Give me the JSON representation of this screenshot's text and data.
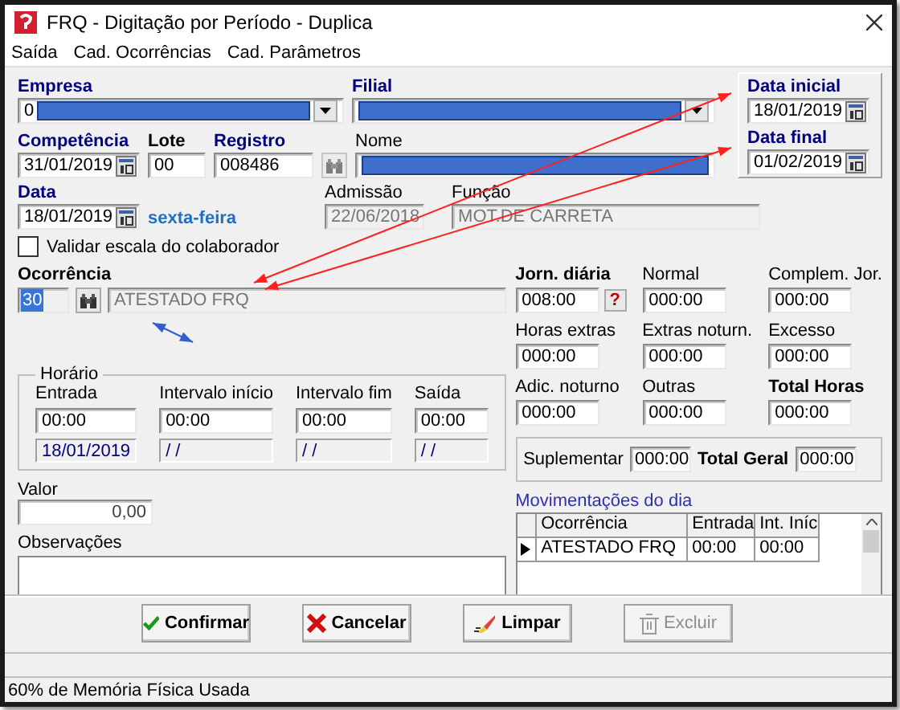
{
  "window": {
    "title": "FRQ - Digitação por Período - Duplica"
  },
  "menu": [
    {
      "label": "Saída"
    },
    {
      "label": "Cad. Ocorrências"
    },
    {
      "label": "Cad. Parâmetros"
    }
  ],
  "empresa": {
    "label": "Empresa",
    "value": "0",
    "kind": "required"
  },
  "filial": {
    "label": "Filial",
    "kind": "required"
  },
  "data_inicial": {
    "label": "Data inicial",
    "value": "18/01/2019",
    "kind": "required"
  },
  "data_final": {
    "label": "Data final",
    "value": "01/02/2019",
    "kind": "required"
  },
  "competencia": {
    "label": "Competência",
    "value": "31/01/2019",
    "kind": "required"
  },
  "lote": {
    "label": "Lote",
    "value": "00",
    "kind": "bold"
  },
  "registro": {
    "label": "Registro",
    "value": "008486",
    "kind": "required"
  },
  "nome": {
    "label": "Nome"
  },
  "data": {
    "label": "Data",
    "value": "18/01/2019",
    "kind": "required",
    "weekday": "sexta-feira"
  },
  "admissao": {
    "label": "Admissão",
    "value": "22/06/2018",
    "disabled": true
  },
  "funcao": {
    "label": "Função",
    "value": "MOT.DE CARRETA",
    "disabled": true
  },
  "validar": {
    "label": "Validar escala do colaborador",
    "checked": false
  },
  "ocorrencia": {
    "label": "Ocorrência",
    "kind": "bold",
    "code": "30",
    "description": "ATESTADO FRQ"
  },
  "horario": {
    "title": "Horário",
    "columns": [
      {
        "label": "Entrada",
        "time": "00:00",
        "date": "18/01/2019"
      },
      {
        "label": "Intervalo início",
        "time": "00:00",
        "date": "/ /"
      },
      {
        "label": "Intervalo fim",
        "time": "00:00",
        "date": "/ /"
      },
      {
        "label": "Saída",
        "time": "00:00",
        "date": "/ /"
      }
    ]
  },
  "valor": {
    "label": "Valor",
    "value": "0,00"
  },
  "observacoes": {
    "label": "Observações"
  },
  "totals": [
    {
      "label": "Jorn. diária",
      "value": "008:00",
      "kind": "bold",
      "help": "?"
    },
    {
      "label": "Normal",
      "value": "000:00",
      "kind": "plain"
    },
    {
      "label": "Complem. Jor.",
      "value": "000:00",
      "kind": "plain"
    },
    {
      "label": "Horas extras",
      "value": "000:00",
      "kind": "plain"
    },
    {
      "label": "Extras noturn.",
      "value": "000:00",
      "kind": "plain"
    },
    {
      "label": "Excesso",
      "value": "000:00",
      "kind": "plain"
    },
    {
      "label": "Adic. noturno",
      "value": "000:00",
      "kind": "plain"
    },
    {
      "label": "Outras",
      "value": "000:00",
      "kind": "plain"
    },
    {
      "label": "Total Horas",
      "value": "000:00",
      "kind": "bold"
    }
  ],
  "suplementar": {
    "label": "Suplementar",
    "value": "000:00"
  },
  "total_geral": {
    "label": "Total Geral",
    "value": "000:00"
  },
  "movimentacoes": {
    "title": "Movimentações do dia",
    "columns": [
      "Ocorrência",
      "Entrada",
      "Int. Iníc"
    ],
    "rows": [
      {
        "cells": [
          "ATESTADO FRQ",
          "00:00",
          "00:00"
        ],
        "selected": true
      }
    ]
  },
  "buttons": [
    {
      "label": "Confirmar",
      "kind": "confirm",
      "disabled": false
    },
    {
      "label": "Cancelar",
      "kind": "cancel",
      "disabled": false
    },
    {
      "label": "Limpar",
      "kind": "clear",
      "disabled": false
    },
    {
      "label": "Excluir",
      "kind": "delete",
      "disabled": true
    }
  ],
  "status_bar": "60% de Memória Física Usada"
}
